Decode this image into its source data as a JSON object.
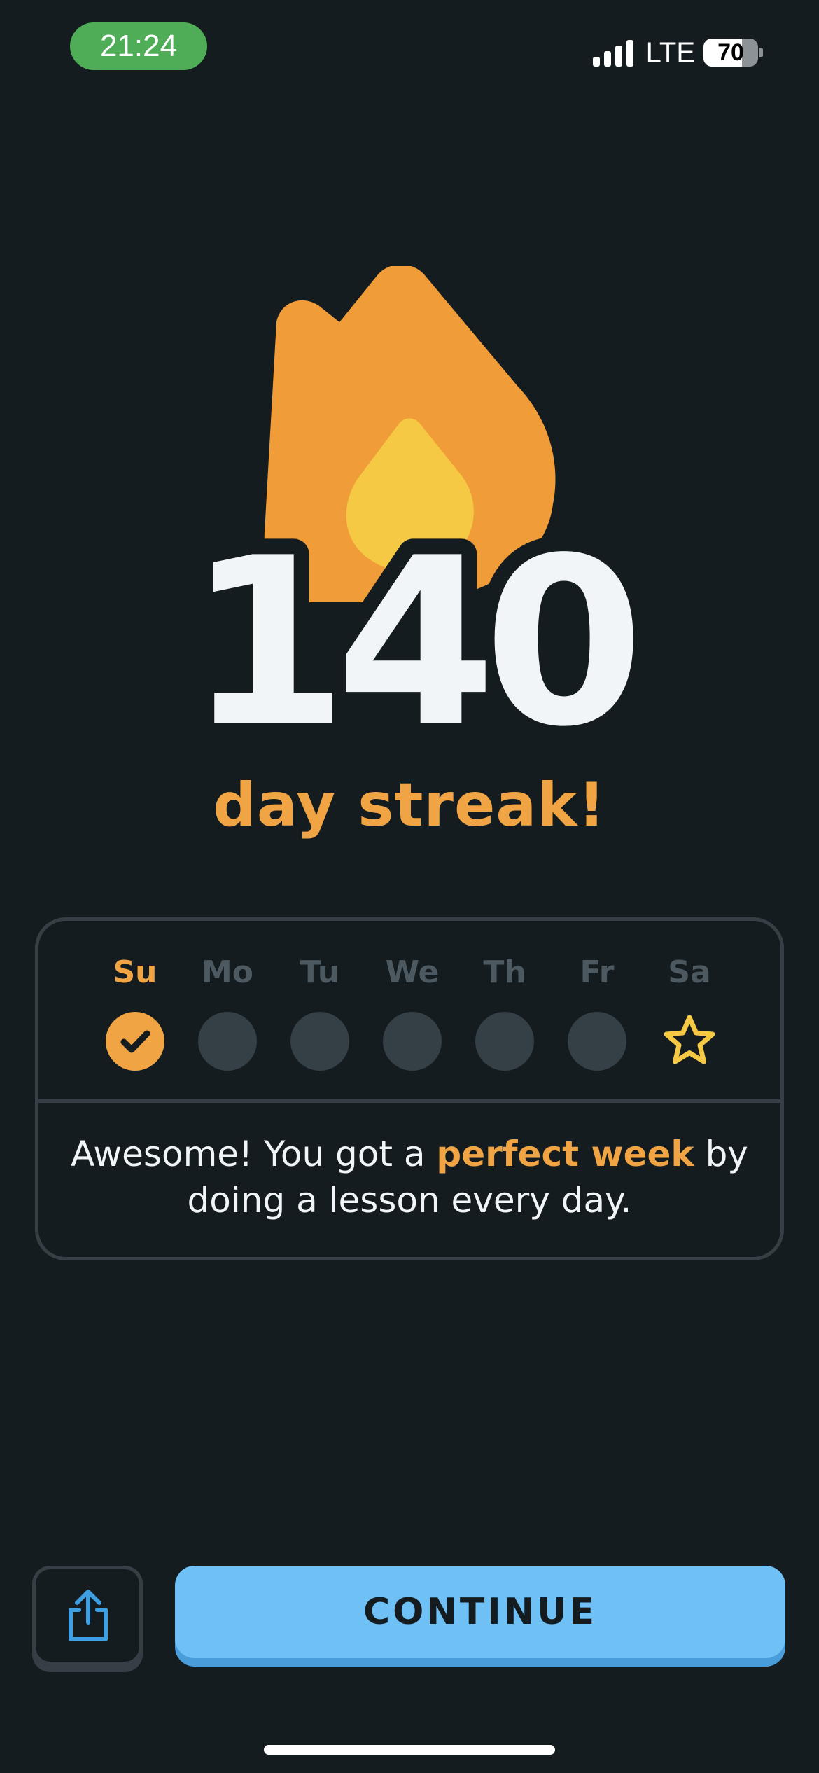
{
  "status_bar": {
    "time": "21:24",
    "network": "LTE",
    "battery_level": "70",
    "battery_fraction": 0.7
  },
  "streak": {
    "count": "140",
    "subtitle": "day streak!"
  },
  "week": {
    "days": [
      {
        "label": "Su",
        "state": "done"
      },
      {
        "label": "Mo",
        "state": "empty"
      },
      {
        "label": "Tu",
        "state": "empty"
      },
      {
        "label": "We",
        "state": "empty"
      },
      {
        "label": "Th",
        "state": "empty"
      },
      {
        "label": "Fr",
        "state": "empty"
      },
      {
        "label": "Sa",
        "state": "goal-star"
      }
    ],
    "message_before": "Awesome! You got a ",
    "message_highlight": "perfect week",
    "message_after": " by doing a lesson every day."
  },
  "buttons": {
    "share_icon": "share-icon",
    "continue_label": "CONTINUE"
  },
  "colors": {
    "background": "#151c20",
    "accent_orange": "#f0a444",
    "flame_inner": "#f6c945",
    "continue_blue": "#6ec0f5",
    "status_green": "#4fad57"
  }
}
